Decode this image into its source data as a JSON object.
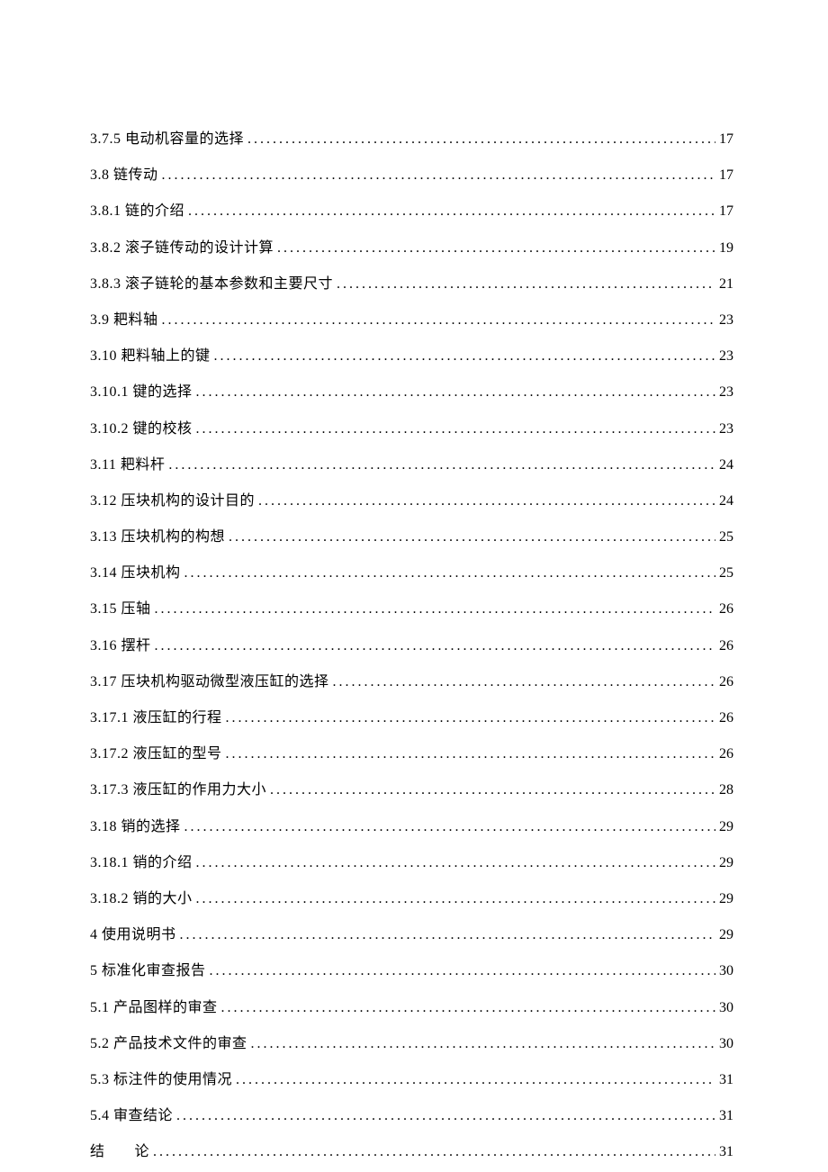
{
  "toc": [
    {
      "label": "3.7.5 电动机容量的选择",
      "page": "17"
    },
    {
      "label": "3.8 链传动",
      "page": "17"
    },
    {
      "label": "3.8.1 链的介绍",
      "page": "17"
    },
    {
      "label": "3.8.2 滚子链传动的设计计算",
      "page": "19"
    },
    {
      "label": "3.8.3 滚子链轮的基本参数和主要尺寸",
      "page": "21"
    },
    {
      "label": "3.9 耙料轴",
      "page": "23"
    },
    {
      "label": "3.10 耙料轴上的键",
      "page": "23"
    },
    {
      "label": "3.10.1 键的选择",
      "page": "23"
    },
    {
      "label": "3.10.2 键的校核",
      "page": "23"
    },
    {
      "label": "3.11 耙料杆",
      "page": "24"
    },
    {
      "label": "3.12 压块机构的设计目的",
      "page": "24"
    },
    {
      "label": "3.13 压块机构的构想",
      "page": "25"
    },
    {
      "label": "3.14 压块机构",
      "page": "25"
    },
    {
      "label": "3.15 压轴",
      "page": "26"
    },
    {
      "label": "3.16 摆杆",
      "page": "26"
    },
    {
      "label": "3.17 压块机构驱动微型液压缸的选择",
      "page": "26"
    },
    {
      "label": "3.17.1 液压缸的行程",
      "page": "26"
    },
    {
      "label": "3.17.2 液压缸的型号",
      "page": "26"
    },
    {
      "label": "3.17.3 液压缸的作用力大小",
      "page": "28"
    },
    {
      "label": "3.18 销的选择",
      "page": "29"
    },
    {
      "label": "3.18.1 销的介绍",
      "page": "29"
    },
    {
      "label": "3.18.2 销的大小",
      "page": "29"
    },
    {
      "label": "4 使用说明书",
      "page": "29"
    },
    {
      "label": "5 标准化审查报告",
      "page": "30"
    },
    {
      "label": "5.1 产品图样的审查",
      "page": "30"
    },
    {
      "label": "5.2 产品技术文件的审查",
      "page": "30"
    },
    {
      "label": "5.3 标注件的使用情况",
      "page": "31"
    },
    {
      "label": "5.4 审查结论",
      "page": "31"
    },
    {
      "label": "结　　论",
      "page": "31"
    }
  ]
}
